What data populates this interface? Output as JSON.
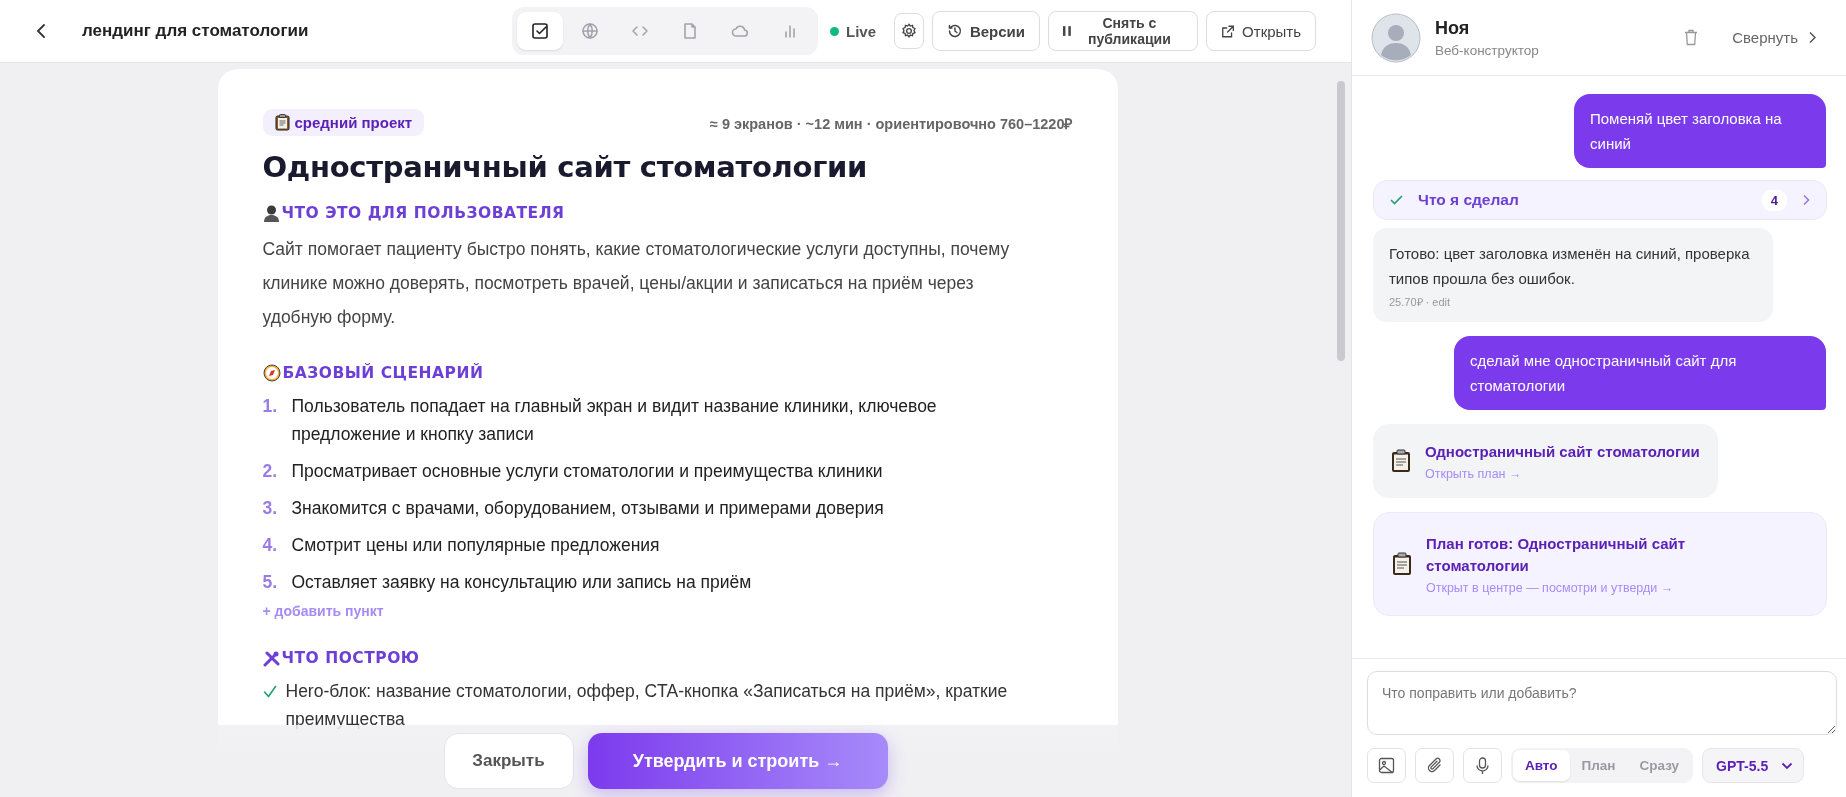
{
  "top_bar": {
    "title": "лендинг для стоматологии",
    "tools": [
      {
        "kind": "checklist",
        "selected": true
      },
      {
        "kind": "globe",
        "selected": false
      },
      {
        "kind": "code",
        "selected": false
      },
      {
        "kind": "file",
        "selected": false
      },
      {
        "kind": "cloud",
        "selected": false
      },
      {
        "kind": "chart",
        "selected": false
      }
    ],
    "status": {
      "label": "Live",
      "live": true
    },
    "buttons": [
      {
        "kind": "versions",
        "label": "Версии"
      },
      {
        "kind": "unpublish",
        "label": "Снять с публикации"
      },
      {
        "kind": "open",
        "label": "Открыть"
      }
    ]
  },
  "plan": {
    "badge": "средний проект",
    "meta": "≈ 9 экранов · ~12 мин · ориентировочно 760–1220₽",
    "title": "Одностраничный сайт стоматологии",
    "sections": [
      {
        "kind": "paragraph",
        "heading": "ЧТО ЭТО ДЛЯ ПОЛЬЗОВАТЕЛЯ",
        "text": "Сайт помогает пациенту быстро понять, какие стоматологические услуги доступны, почему клинике можно доверять, посмотреть врачей, цены/акции и записаться на приём через удобную форму."
      },
      {
        "kind": "steps",
        "heading": "БАЗОВЫЙ СЦЕНАРИЙ",
        "add_link": "+ добавить пункт",
        "items": [
          {
            "number": "1.",
            "text": "Пользователь попадает на главный экран и видит название клиники, ключевое предложение и кнопку записи"
          },
          {
            "number": "2.",
            "text": "Просматривает основные услуги стоматологии и преимущества клиники"
          },
          {
            "number": "3.",
            "text": "Знакомится с врачами, оборудованием, отзывами и примерами доверия"
          },
          {
            "number": "4.",
            "text": "Смотрит цены или популярные предложения"
          },
          {
            "number": "5.",
            "text": "Оставляет заявку на консультацию или запись на приём"
          }
        ]
      },
      {
        "kind": "checklist",
        "heading": "ЧТО ПОСТРОЮ",
        "items": [
          {
            "text": "Hero-блок: название стоматологии, оффер, CTA-кнопка «Записаться на приём», краткие преимущества"
          }
        ]
      }
    ]
  },
  "actions": {
    "close": "Закрыть",
    "approve": "Утвердить и строить →"
  },
  "chat": {
    "name": "Ноя",
    "role": "Веб-конструктор",
    "collapse": "Свернуть",
    "messages": [
      {
        "kind": "user",
        "text": "Поменяй цвет заголовка на синий"
      },
      {
        "kind": "summary",
        "label": "Что я сделал",
        "count": "4",
        "done": true
      },
      {
        "kind": "assistant",
        "text": "Готово: цвет заголовка изменён на синий, проверка типов прошла без ошибок.",
        "meta": "25.70₽ · edit"
      },
      {
        "kind": "user",
        "text": "сделай мне одностраничный сайт для стоматологии"
      },
      {
        "kind": "plan_link",
        "title": "Одностраничный сайт стоматологии",
        "link": "Открыть план →"
      },
      {
        "kind": "plan_ready",
        "title": "План готов: Одностраничный сайт стоматологии",
        "link": "Открыт в центре — посмотри и утверди →"
      }
    ],
    "input": {
      "placeholder": "Что поправить или добавить?"
    },
    "modes": [
      {
        "label": "Авто",
        "selected": true
      },
      {
        "label": "План",
        "selected": false
      },
      {
        "label": "Сразу",
        "selected": false
      }
    ],
    "model": "GPT-5.5"
  }
}
